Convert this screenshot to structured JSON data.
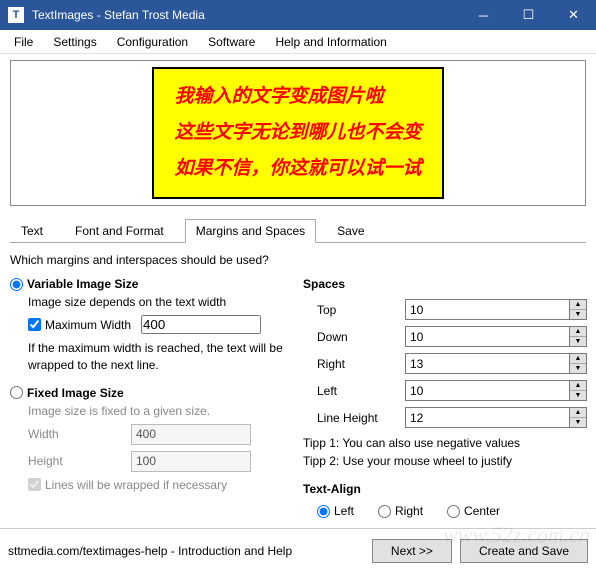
{
  "titlebar": {
    "app_icon": "T",
    "title": "TextImages - Stefan Trost Media"
  },
  "menubar": {
    "items": [
      "File",
      "Settings",
      "Configuration",
      "Software",
      "Help and Information"
    ]
  },
  "preview": {
    "lines": [
      "我输入的文字变成图片啦",
      "这些文字无论到哪儿也不会变",
      "如果不信，你这就可以试一试"
    ]
  },
  "tabs": {
    "text": "Text",
    "font_format": "Font and Format",
    "margins": "Margins and Spaces",
    "save": "Save"
  },
  "help_text": "Which margins and interspaces should be used?",
  "variable": {
    "title": "Variable Image Size",
    "desc": "Image size depends on the text width",
    "max_width_label": "Maximum Width",
    "max_width_value": "400",
    "note": "If the maximum width is reached, the text will be wrapped to the next line."
  },
  "fixed": {
    "title": "Fixed Image Size",
    "desc": "Image size is fixed to a given size.",
    "width_label": "Width",
    "width_value": "400",
    "height_label": "Height",
    "height_value": "100",
    "wrap_label": "Lines will be wrapped if necessary"
  },
  "spaces": {
    "title": "Spaces",
    "top_label": "Top",
    "top_value": "10",
    "down_label": "Down",
    "down_value": "10",
    "right_label": "Right",
    "right_value": "13",
    "left_label": "Left",
    "left_value": "10",
    "lh_label": "Line Height",
    "lh_value": "12",
    "tipp1": "Tipp 1: You can also use negative values",
    "tipp2": "Tipp 2: Use your mouse wheel to justify"
  },
  "align": {
    "title": "Text-Align",
    "left": "Left",
    "right": "Right",
    "center": "Center"
  },
  "footer": {
    "status": "sttmedia.com/textimages-help - Introduction and Help",
    "next": "Next >>",
    "create": "Create and Save"
  },
  "watermark": "www.52z.com.cn"
}
